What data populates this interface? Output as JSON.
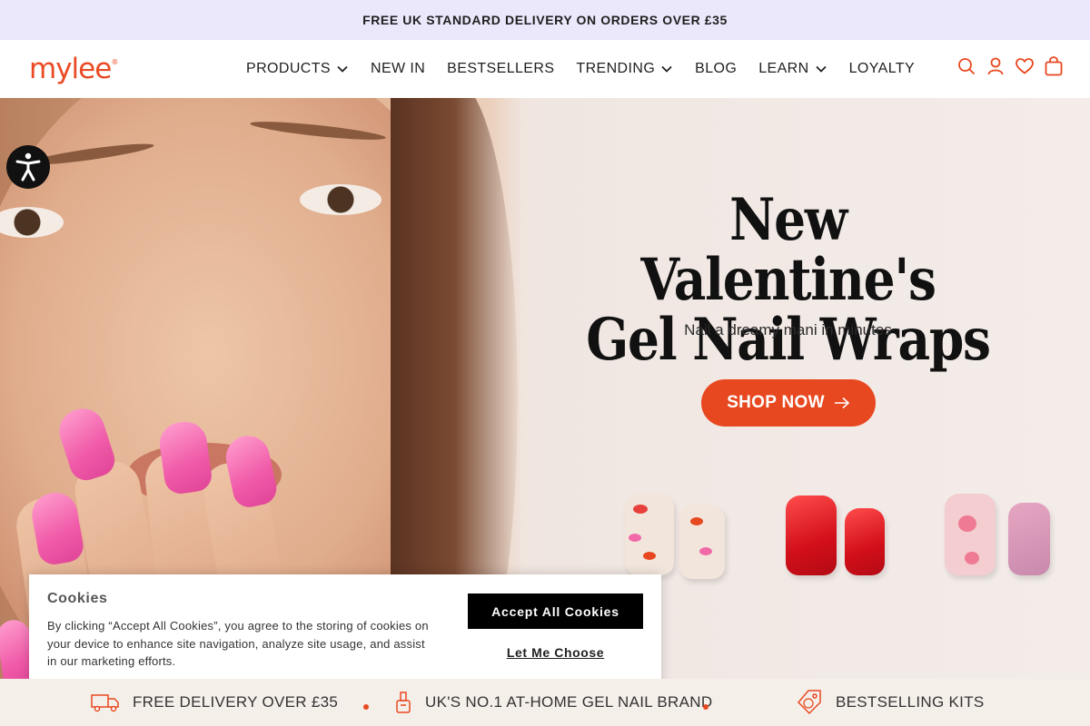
{
  "promo": {
    "text": "FREE UK STANDARD DELIVERY ON ORDERS OVER £35"
  },
  "header": {
    "logo": "mylee",
    "nav": [
      {
        "label": "PRODUCTS",
        "has_dropdown": true
      },
      {
        "label": "NEW IN",
        "has_dropdown": false
      },
      {
        "label": "BESTSELLERS",
        "has_dropdown": false
      },
      {
        "label": "TRENDING",
        "has_dropdown": true
      },
      {
        "label": "BLOG",
        "has_dropdown": false
      },
      {
        "label": "LEARN",
        "has_dropdown": true
      },
      {
        "label": "LOYALTY",
        "has_dropdown": false
      }
    ],
    "icons": [
      "search-icon",
      "account-icon",
      "wishlist-heart-icon",
      "cart-bag-icon"
    ]
  },
  "hero": {
    "title_line1": "New Valentine's",
    "title_line2": "Gel Nail Wraps",
    "subtitle": "Nail a dreamy mani in minutes",
    "cta": "SHOP NOW"
  },
  "cookies": {
    "title": "Cookies",
    "text": "By clicking “Accept All Cookies”, you agree to the storing of cookies on your device to enhance site navigation, analyze site usage, and assist in our marketing efforts.",
    "accept": "Accept All Cookies",
    "choose": "Let Me Choose"
  },
  "usps": [
    {
      "label": "FREE DELIVERY OVER £35",
      "icon": "delivery-truck-icon"
    },
    {
      "label": "UK'S NO.1 AT-HOME GEL NAIL BRAND",
      "icon": "nail-polish-bottle-icon"
    },
    {
      "label": "BESTSELLING KITS",
      "icon": "price-tag-icon"
    }
  ],
  "colors": {
    "accent": "#e84820",
    "promo_bg": "#ece8fb",
    "usp_bg": "#f5efea",
    "nail_pink": "#f05aa8"
  }
}
